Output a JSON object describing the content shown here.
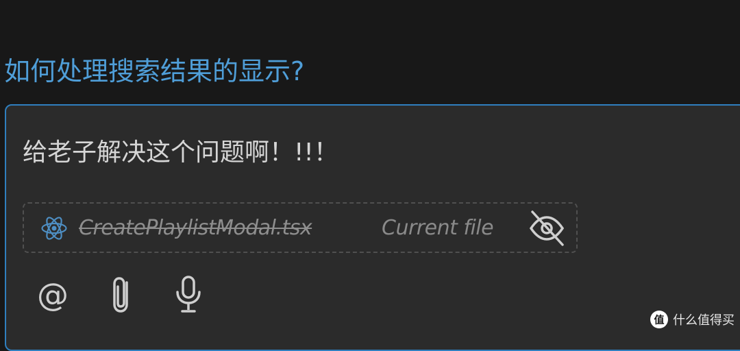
{
  "question": {
    "text": "如何处理搜索结果的显示?"
  },
  "chat_input": {
    "message": "给老子解决这个问题啊！!!！",
    "file_chip": {
      "icon": "react-icon",
      "file_name": "CreatePlaylistModal.tsx",
      "tag": "Current file",
      "visibility_icon": "eye-off-icon"
    },
    "toolbar": {
      "mention_label": "@",
      "mention_icon": "at-icon",
      "attach_icon": "paperclip-icon",
      "mic_icon": "microphone-icon"
    }
  },
  "watermark": {
    "text": "什么值得买",
    "logo": "zhi-logo"
  },
  "colors": {
    "background": "#181818",
    "question_text": "#4f9ed8",
    "chat_box": "#2b2b2b",
    "chat_border": "#2f7fbf",
    "react_icon": "#4e8fc4"
  }
}
